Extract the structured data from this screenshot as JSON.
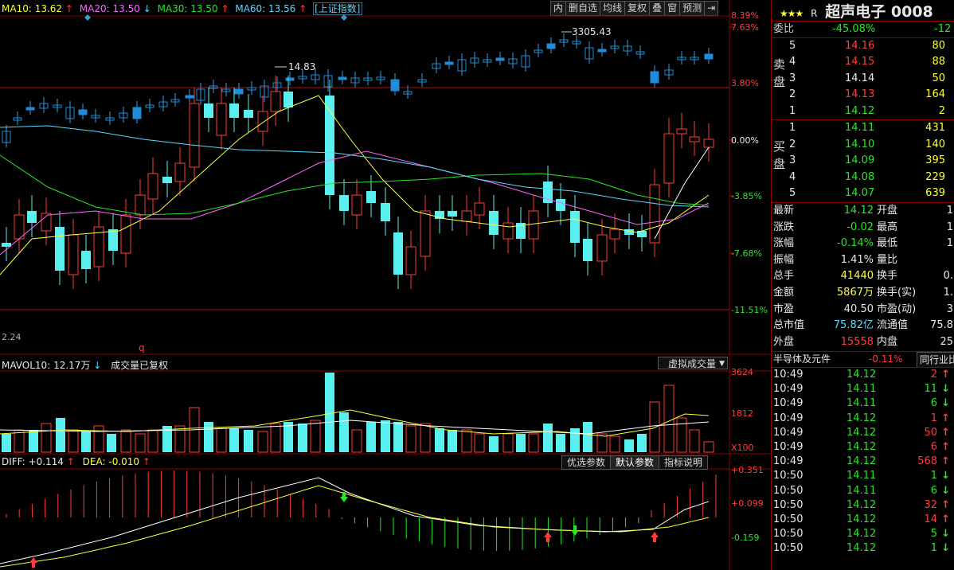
{
  "chart_header": {
    "ma10_label": "MA10:",
    "ma10_value": "13.62",
    "ma20_label": "MA20:",
    "ma20_value": "13.50",
    "ma30_label": "MA30:",
    "ma30_value": "13.50",
    "ma60_label": "MA60:",
    "ma60_value": "13.56",
    "index_tag": "[上证指数]",
    "colors": {
      "ma10": "#ffff3c",
      "ma20": "#ff66ff",
      "ma30": "#28e628",
      "ma60": "#5ad8ff"
    }
  },
  "toolbar": {
    "buttons": [
      "内",
      "删自选",
      "均线",
      "复权",
      "叠",
      "窗",
      "预测"
    ],
    "expand_icon": "collapse-right-icon"
  },
  "price_axis": {
    "labels": [
      "8.39%",
      "7.63%",
      "3.80%",
      "0.00%",
      "-3.85%",
      "-7.68%",
      "-11.51%"
    ]
  },
  "annotations": {
    "peak_value": "3305.43",
    "local_high": "14.83",
    "low_value": "2.24",
    "marker_q": "q"
  },
  "volume_panel": {
    "label": "MAVOL10:",
    "value": "12.17万",
    "note": "成交量已复权",
    "dropdown": "虚拟成交量",
    "axis": [
      "3624",
      "1812",
      "X100"
    ]
  },
  "macd_panel": {
    "diff_label": "DIFF:",
    "diff_value": "+0.114",
    "dea_label": "DEA:",
    "dea_value": "-0.010",
    "tabs": [
      "优选参数",
      "默认参数",
      "指标说明"
    ],
    "axis": [
      "+0.351",
      "+0.099",
      "-0.159"
    ]
  },
  "quote": {
    "stars": "★★★",
    "r_mark": "R",
    "name": "超声电子 0008",
    "weibi_label": "委比",
    "weibi_value": "-45.08%",
    "weicha_value": "-12",
    "sell_side_label": [
      "卖",
      "盘"
    ],
    "buy_side_label": [
      "买",
      "盘"
    ],
    "sell": [
      {
        "lvl": "5",
        "price": "14.16",
        "vol": "80"
      },
      {
        "lvl": "4",
        "price": "14.15",
        "vol": "88"
      },
      {
        "lvl": "3",
        "price": "14.14",
        "vol": "50"
      },
      {
        "lvl": "2",
        "price": "14.13",
        "vol": "164"
      },
      {
        "lvl": "1",
        "price": "14.12",
        "vol": "2"
      }
    ],
    "buy": [
      {
        "lvl": "1",
        "price": "14.11",
        "vol": "431"
      },
      {
        "lvl": "2",
        "price": "14.10",
        "vol": "140"
      },
      {
        "lvl": "3",
        "price": "14.09",
        "vol": "395"
      },
      {
        "lvl": "4",
        "price": "14.08",
        "vol": "229"
      },
      {
        "lvl": "5",
        "price": "14.07",
        "vol": "639"
      }
    ],
    "stats": [
      {
        "l1": "最新",
        "v1": "14.12",
        "l2": "开盘",
        "v2": "1"
      },
      {
        "l1": "涨跌",
        "v1": "-0.02",
        "l2": "最高",
        "v2": "1"
      },
      {
        "l1": "涨幅",
        "v1": "-0.14%",
        "l2": "最低",
        "v2": "1"
      },
      {
        "l1": "振幅",
        "v1": "1.41%",
        "l2": "量比",
        "v2": ""
      },
      {
        "l1": "总手",
        "v1": "41440",
        "l2": "换手",
        "v2": "0."
      },
      {
        "l1": "金额",
        "v1": "5867万",
        "l2": "换手(实)",
        "v2": "1."
      },
      {
        "l1": "市盈",
        "v1": "40.50",
        "l2": "市盈(动)",
        "v2": "3"
      },
      {
        "l1": "总市值",
        "v1": "75.82亿",
        "l2": "流通值",
        "v2": "75.8"
      },
      {
        "l1": "外盘",
        "v1": "15558",
        "l2": "内盘",
        "v2": "25"
      }
    ],
    "sector_name": "半导体及元件",
    "sector_change": "-0.11%",
    "sector_link": "同行业比",
    "ticks": [
      {
        "t": "10:49",
        "p": "14.12",
        "v": "2",
        "dir": "up"
      },
      {
        "t": "10:49",
        "p": "14.11",
        "v": "11",
        "dir": "down"
      },
      {
        "t": "10:49",
        "p": "14.11",
        "v": "6",
        "dir": "down"
      },
      {
        "t": "10:49",
        "p": "14.12",
        "v": "1",
        "dir": "up"
      },
      {
        "t": "10:49",
        "p": "14.12",
        "v": "50",
        "dir": "up"
      },
      {
        "t": "10:49",
        "p": "14.12",
        "v": "6",
        "dir": "up"
      },
      {
        "t": "10:49",
        "p": "14.12",
        "v": "568",
        "dir": "up"
      },
      {
        "t": "10:50",
        "p": "14.11",
        "v": "1",
        "dir": "down"
      },
      {
        "t": "10:50",
        "p": "14.11",
        "v": "6",
        "dir": "down"
      },
      {
        "t": "10:50",
        "p": "14.12",
        "v": "32",
        "dir": "up"
      },
      {
        "t": "10:50",
        "p": "14.12",
        "v": "14",
        "dir": "up"
      },
      {
        "t": "10:50",
        "p": "14.12",
        "v": "5",
        "dir": "down"
      },
      {
        "t": "10:50",
        "p": "14.12",
        "v": "1",
        "dir": "down"
      }
    ]
  }
}
